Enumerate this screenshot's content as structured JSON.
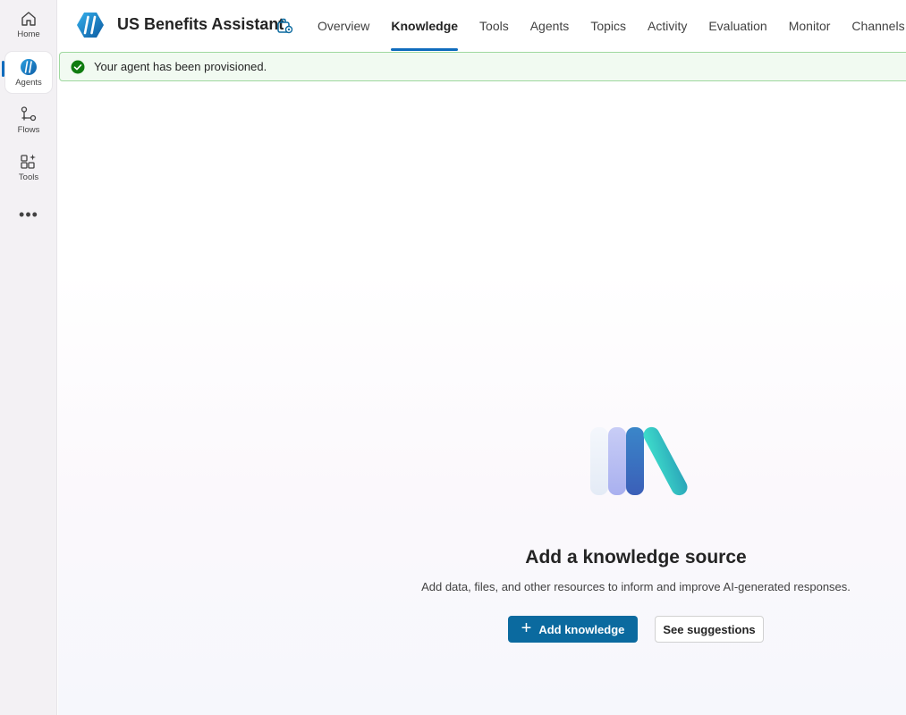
{
  "rail": {
    "items": [
      {
        "label": "Home",
        "icon": "home-icon"
      },
      {
        "label": "Agents",
        "icon": "agents-icon"
      },
      {
        "label": "Flows",
        "icon": "flows-icon"
      },
      {
        "label": "Tools",
        "icon": "tools-icon"
      }
    ],
    "more_label": "•••"
  },
  "header": {
    "agent_name": "US Benefits Assistant",
    "tabs": [
      {
        "label": "Overview"
      },
      {
        "label": "Knowledge"
      },
      {
        "label": "Tools"
      },
      {
        "label": "Agents"
      },
      {
        "label": "Topics"
      },
      {
        "label": "Activity"
      },
      {
        "label": "Evaluation"
      },
      {
        "label": "Monitor"
      },
      {
        "label": "Channels"
      }
    ],
    "active_tab": "Knowledge"
  },
  "banner": {
    "message": "Your agent has been provisioned.",
    "status_color": "#107c10"
  },
  "empty_state": {
    "title": "Add a knowledge source",
    "description": "Add data, files, and other resources to inform and improve AI-generated responses.",
    "primary_button": "Add knowledge",
    "secondary_button": "See suggestions"
  },
  "colors": {
    "accent": "#0f6cbd",
    "primary_button": "#0b6a9f"
  }
}
